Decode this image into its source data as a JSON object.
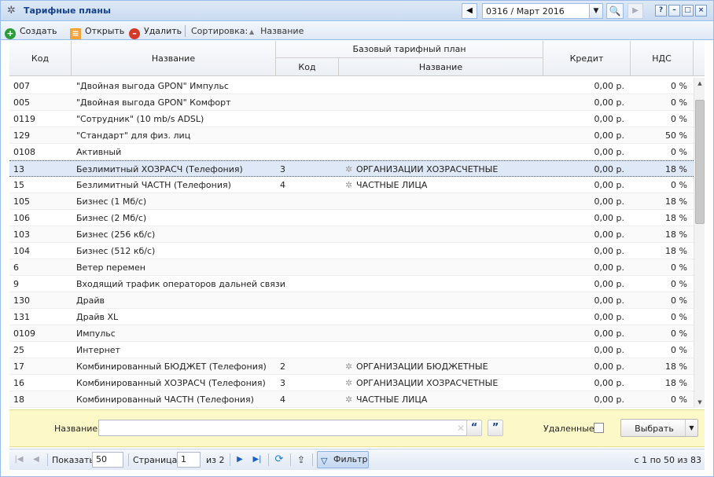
{
  "window": {
    "title": "Тарифные планы",
    "period": "0316 / Март 2016"
  },
  "toolbar": {
    "create": "Создать",
    "open": "Открыть",
    "delete": "Удалить",
    "sort_label": "Сортировка:",
    "sort_field": "Название"
  },
  "grid": {
    "headers": {
      "code": "Код",
      "name": "Название",
      "base_plan": "Базовый тарифный план",
      "base_code": "Код",
      "base_name": "Название",
      "credit": "Кредит",
      "vat": "НДС"
    },
    "rows": [
      {
        "code": "007",
        "name": "\"Двойная выгода GPON\" Импульс",
        "bcode": "",
        "bname": "",
        "credit": "0,00 р.",
        "vat": "0 %"
      },
      {
        "code": "005",
        "name": "\"Двойная выгода GPON\" Комфорт",
        "bcode": "",
        "bname": "",
        "credit": "0,00 р.",
        "vat": "0 %"
      },
      {
        "code": "0119",
        "name": "\"Сотрудник\" (10 mb/s ADSL)",
        "bcode": "",
        "bname": "",
        "credit": "0,00 р.",
        "vat": "0 %"
      },
      {
        "code": "129",
        "name": "\"Стандарт\" для физ. лиц",
        "bcode": "",
        "bname": "",
        "credit": "0,00 р.",
        "vat": "50 %"
      },
      {
        "code": "0108",
        "name": "Активный",
        "bcode": "",
        "bname": "",
        "credit": "0,00 р.",
        "vat": "0 %"
      },
      {
        "code": "13",
        "name": "Безлимитный ХОЗРАСЧ (Телефония)",
        "bcode": "3",
        "bname": "ОРГАНИЗАЦИИ ХОЗРАСЧЕТНЫЕ",
        "credit": "0,00 р.",
        "vat": "18 %"
      },
      {
        "code": "15",
        "name": "Безлимитный ЧАСТН (Телефония)",
        "bcode": "4",
        "bname": "ЧАСТНЫЕ ЛИЦА",
        "credit": "0,00 р.",
        "vat": "0 %"
      },
      {
        "code": "105",
        "name": "Бизнес (1 Мб/с)",
        "bcode": "",
        "bname": "",
        "credit": "0,00 р.",
        "vat": "18 %"
      },
      {
        "code": "106",
        "name": "Бизнес (2 Мб/с)",
        "bcode": "",
        "bname": "",
        "credit": "0,00 р.",
        "vat": "18 %"
      },
      {
        "code": "103",
        "name": "Бизнес (256 кб/с)",
        "bcode": "",
        "bname": "",
        "credit": "0,00 р.",
        "vat": "18 %"
      },
      {
        "code": "104",
        "name": "Бизнес (512 кб/с)",
        "bcode": "",
        "bname": "",
        "credit": "0,00 р.",
        "vat": "18 %"
      },
      {
        "code": "6",
        "name": "Ветер перемен",
        "bcode": "",
        "bname": "",
        "credit": "0,00 р.",
        "vat": "0 %"
      },
      {
        "code": "9",
        "name": "Входящий трафик операторов дальней связи",
        "bcode": "",
        "bname": "",
        "credit": "0,00 р.",
        "vat": "0 %"
      },
      {
        "code": "130",
        "name": "Драйв",
        "bcode": "",
        "bname": "",
        "credit": "0,00 р.",
        "vat": "0 %"
      },
      {
        "code": "131",
        "name": "Драйв XL",
        "bcode": "",
        "bname": "",
        "credit": "0,00 р.",
        "vat": "0 %"
      },
      {
        "code": "0109",
        "name": "Импульс",
        "bcode": "",
        "bname": "",
        "credit": "0,00 р.",
        "vat": "0 %"
      },
      {
        "code": "25",
        "name": "Интернет",
        "bcode": "",
        "bname": "",
        "credit": "0,00 р.",
        "vat": "0 %"
      },
      {
        "code": "17",
        "name": "Комбинированный БЮДЖЕТ (Телефония)",
        "bcode": "2",
        "bname": "ОРГАНИЗАЦИИ БЮДЖЕТНЫЕ",
        "credit": "0,00 р.",
        "vat": "18 %"
      },
      {
        "code": "16",
        "name": "Комбинированный ХОЗРАСЧ (Телефония)",
        "bcode": "3",
        "bname": "ОРГАНИЗАЦИИ ХОЗРАСЧЕТНЫЕ",
        "credit": "0,00 р.",
        "vat": "18 %"
      },
      {
        "code": "18",
        "name": "Комбинированный ЧАСТН (Телефония)",
        "bcode": "4",
        "bname": "ЧАСТНЫЕ ЛИЦА",
        "credit": "0,00 р.",
        "vat": "0 %"
      }
    ]
  },
  "filter": {
    "name_label": "Название:",
    "name_value": "",
    "deleted_label": "Удаленные:",
    "select_button": "Выбрать"
  },
  "pager": {
    "show_label": "Показать",
    "page_size": "50",
    "page_label": "Страница",
    "page": "1",
    "of_pages": "из 2",
    "filter_button": "Фильтр",
    "info": "с 1 по 50 из 83"
  }
}
